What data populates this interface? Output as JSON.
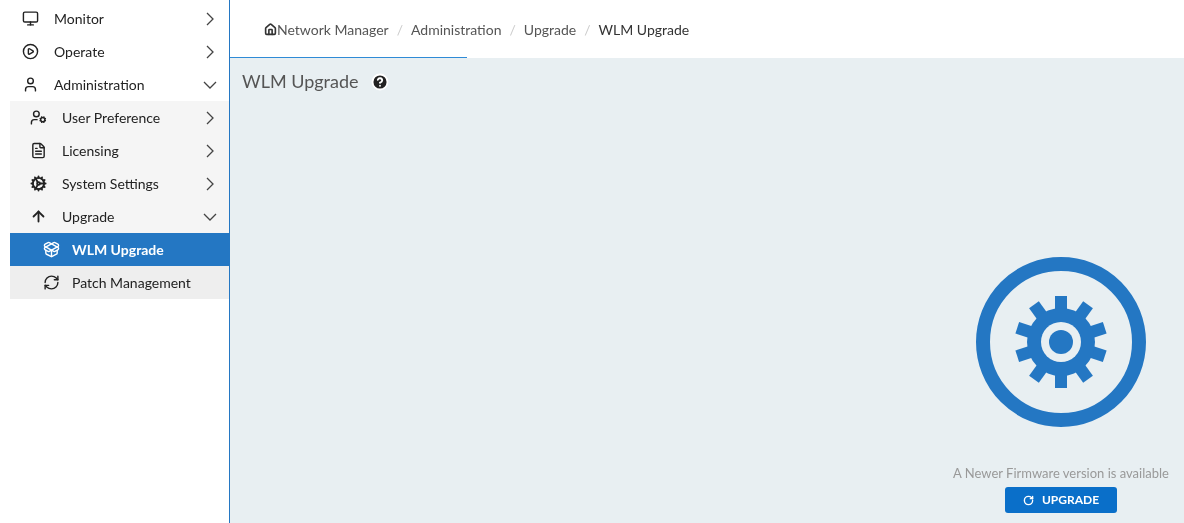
{
  "sidebar": {
    "items": [
      {
        "label": "Monitor",
        "expanded": false
      },
      {
        "label": "Operate",
        "expanded": false
      },
      {
        "label": "Administration",
        "expanded": true,
        "children": [
          {
            "label": "User Preference",
            "expanded": false
          },
          {
            "label": "Licensing",
            "expanded": false
          },
          {
            "label": "System Settings",
            "expanded": false
          },
          {
            "label": "Upgrade",
            "expanded": true,
            "children": [
              {
                "label": "WLM Upgrade",
                "selected": true
              },
              {
                "label": "Patch Management",
                "selected": false
              }
            ]
          }
        ]
      }
    ]
  },
  "breadcrumb": [
    "Network Manager",
    "Administration",
    "Upgrade",
    "WLM Upgrade"
  ],
  "breadcrumb_separator": "/",
  "page_title": "WLM Upgrade",
  "upgrade": {
    "message": "A Newer Firmware version is available",
    "button": "UPGRADE"
  }
}
